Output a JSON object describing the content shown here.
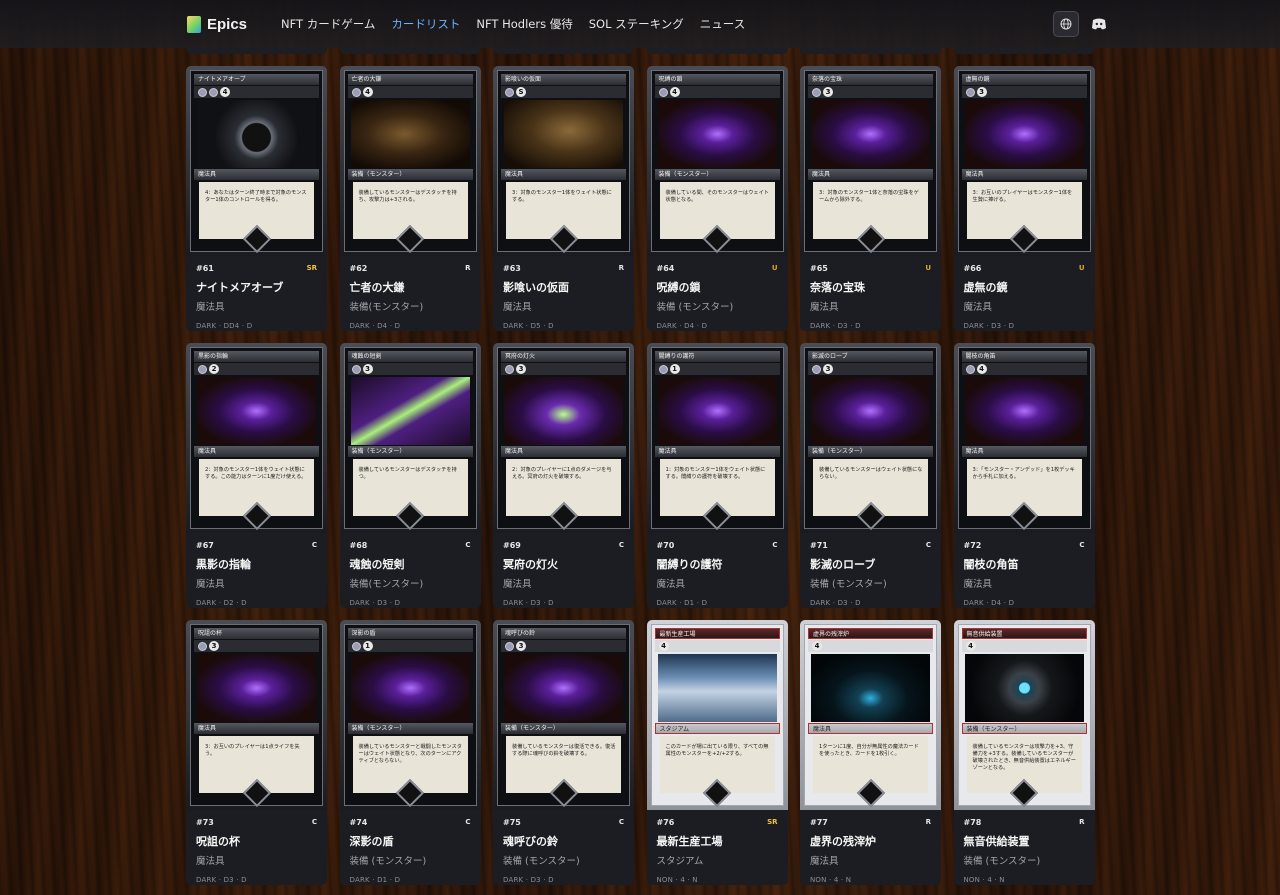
{
  "header": {
    "logo_text": "Epics",
    "nav": [
      "NFT カードゲーム",
      "カードリスト",
      "NFT Hodlers 優待",
      "SOL ステーキング",
      "ニュース"
    ],
    "active_nav_index": 1,
    "icons": {
      "globe": "globe-icon",
      "discord": "discord-icon"
    }
  },
  "cards": [
    {
      "number": "#61",
      "rarity": "SR",
      "title": "ナイトメアオーブ",
      "subtype": "魔法具",
      "meta": "DARK · DD4 · D",
      "card_name": "ナイトメアオーブ",
      "cost": "4",
      "cost_dots": 2,
      "type_line": "魔法具",
      "text": "4：あなたはターン終了時まで対象のモンスター1体のコントロールを得る。",
      "theme": "dark",
      "art": "dark-orb"
    },
    {
      "number": "#62",
      "rarity": "R",
      "title": "亡者の大鎌",
      "subtype": "装備(モンスター)",
      "meta": "DARK · D4 · D",
      "card_name": "亡者の大鎌",
      "cost": "4",
      "cost_dots": 1,
      "type_line": "装備（モンスター）",
      "text": "装備しているモンスターはデスタッチを持ち、攻撃力は+3される。",
      "theme": "dark",
      "art": "reaper"
    },
    {
      "number": "#63",
      "rarity": "R",
      "title": "影喰いの仮面",
      "subtype": "魔法具",
      "meta": "DARK · D5 · D",
      "card_name": "影喰いの仮面",
      "cost": "S",
      "cost_dots": 1,
      "type_line": "魔法具",
      "text": "3：対象のモンスター1体をウェイト状態にする。",
      "theme": "dark",
      "art": "mask"
    },
    {
      "number": "#64",
      "rarity": "U",
      "title": "呪縛の鎖",
      "subtype": "装備 (モンスター)",
      "meta": "DARK · D4 · D",
      "card_name": "呪縛の鎖",
      "cost": "4",
      "cost_dots": 1,
      "type_line": "装備（モンスター）",
      "text": "装備している間、そのモンスターはウェイト状態となる。",
      "theme": "dark",
      "art": "purple"
    },
    {
      "number": "#65",
      "rarity": "U",
      "title": "奈落の宝珠",
      "subtype": "魔法具",
      "meta": "DARK · D3 · D",
      "card_name": "奈落の宝珠",
      "cost": "3",
      "cost_dots": 1,
      "type_line": "魔法具",
      "text": "3：対象のモンスター1体と奈落の宝珠をゲームから除外する。",
      "theme": "dark",
      "art": "purple"
    },
    {
      "number": "#66",
      "rarity": "U",
      "title": "虚無の鏡",
      "subtype": "魔法具",
      "meta": "DARK · D3 · D",
      "card_name": "虚無の鏡",
      "cost": "3",
      "cost_dots": 1,
      "type_line": "魔法具",
      "text": "3：お互いのプレイヤーはモンスター1体を生贄に捧げる。",
      "theme": "dark",
      "art": "purple"
    },
    {
      "number": "#67",
      "rarity": "C",
      "title": "黒影の指輪",
      "subtype": "魔法具",
      "meta": "DARK · D2 · D",
      "card_name": "黒影の指輪",
      "cost": "2",
      "cost_dots": 1,
      "type_line": "魔法具",
      "text": "2：対象のモンスター1体をウェイト状態にする。この能力はターンに1度だけ使える。",
      "theme": "dark",
      "art": "purple"
    },
    {
      "number": "#68",
      "rarity": "C",
      "title": "魂蝕の短剣",
      "subtype": "装備(モンスター)",
      "meta": "DARK · D3 · D",
      "card_name": "魂蝕の短剣",
      "cost": "3",
      "cost_dots": 1,
      "type_line": "装備（モンスター）",
      "text": "装備しているモンスターはデスタッチを持つ。",
      "theme": "dark",
      "art": "dagger"
    },
    {
      "number": "#69",
      "rarity": "C",
      "title": "冥府の灯火",
      "subtype": "魔法具",
      "meta": "DARK · D3 · D",
      "card_name": "冥府の灯火",
      "cost": "3",
      "cost_dots": 1,
      "type_line": "魔法具",
      "text": "2：対象のプレイヤーに1点のダメージを与える。冥府の灯火を破壊する。",
      "theme": "dark",
      "art": "lantern"
    },
    {
      "number": "#70",
      "rarity": "C",
      "title": "闇縛りの護符",
      "subtype": "魔法具",
      "meta": "DARK · D1 · D",
      "card_name": "闇縛りの護符",
      "cost": "1",
      "cost_dots": 1,
      "type_line": "魔法具",
      "text": "1：対象のモンスター1体をウェイト状態にする。闇縛りの護符を破壊する。",
      "theme": "dark",
      "art": "purple"
    },
    {
      "number": "#71",
      "rarity": "C",
      "title": "影滅のローブ",
      "subtype": "装備 (モンスター)",
      "meta": "DARK · D3 · D",
      "card_name": "影滅のローブ",
      "cost": "3",
      "cost_dots": 1,
      "type_line": "装備（モンスター）",
      "text": "装備しているモンスターはウェイト状態にならない。",
      "theme": "dark",
      "art": "purple"
    },
    {
      "number": "#72",
      "rarity": "C",
      "title": "闇枝の角笛",
      "subtype": "魔法具",
      "meta": "DARK · D4 · D",
      "card_name": "闇枝の角笛",
      "cost": "4",
      "cost_dots": 1,
      "type_line": "魔法具",
      "text": "3：「モンスター・アンデッド」を1枚デッキから手札に加える。",
      "theme": "dark",
      "art": "purple"
    },
    {
      "number": "#73",
      "rarity": "C",
      "title": "呪詛の杯",
      "subtype": "魔法具",
      "meta": "DARK · D3 · D",
      "card_name": "呪詛の杯",
      "cost": "3",
      "cost_dots": 1,
      "type_line": "魔法具",
      "text": "3：お互いのプレイヤーは1点ライフを失う。",
      "theme": "dark",
      "art": "purple"
    },
    {
      "number": "#74",
      "rarity": "C",
      "title": "深影の盾",
      "subtype": "装備 (モンスター)",
      "meta": "DARK · D1 · D",
      "card_name": "深影の盾",
      "cost": "1",
      "cost_dots": 1,
      "type_line": "装備（モンスター）",
      "text": "装備しているモンスターと戦闘したモンスターはウェイト状態となり、次のターンにアクティブとならない。",
      "theme": "dark",
      "art": "purple"
    },
    {
      "number": "#75",
      "rarity": "C",
      "title": "魂呼びの鈴",
      "subtype": "装備 (モンスター)",
      "meta": "DARK · D3 · D",
      "card_name": "魂呼びの鈴",
      "cost": "3",
      "cost_dots": 1,
      "type_line": "装備（モンスター）",
      "text": "装備しているモンスターは復活できる。復活する際に魂呼びの鈴を破壊する。",
      "theme": "dark",
      "art": "purple"
    },
    {
      "number": "#76",
      "rarity": "SR",
      "title": "最新生産工場",
      "subtype": "スタジアム",
      "meta": "NON · 4 · N",
      "card_name": "最新生産工場",
      "cost": "4",
      "cost_dots": 0,
      "type_line": "スタジアム",
      "text": "このカードが場に出ている限り、すべての無属性のモンスターを+2/+2する。",
      "theme": "light",
      "art": "factory"
    },
    {
      "number": "#77",
      "rarity": "R",
      "title": "虚界の残滓炉",
      "subtype": "魔法具",
      "meta": "NON · 4 · N",
      "card_name": "虚界の残滓炉",
      "cost": "4",
      "cost_dots": 0,
      "type_line": "魔法具",
      "text": "1ターンに1度、自分が無属性の魔法カードを使ったとき、カードを1枚引く。",
      "theme": "light",
      "art": "void"
    },
    {
      "number": "#78",
      "rarity": "R",
      "title": "無音供給装置",
      "subtype": "装備 (モンスター)",
      "meta": "NON · 4 · N",
      "card_name": "無音供給装置",
      "cost": "4",
      "cost_dots": 0,
      "type_line": "装備（モンスター）",
      "text": "装備しているモンスターは攻撃力を+3、守備力を+3する。装備しているモンスターが破壊されたとき、無音供給装置はエネルギーゾーンとなる。",
      "theme": "light",
      "art": "device"
    }
  ]
}
